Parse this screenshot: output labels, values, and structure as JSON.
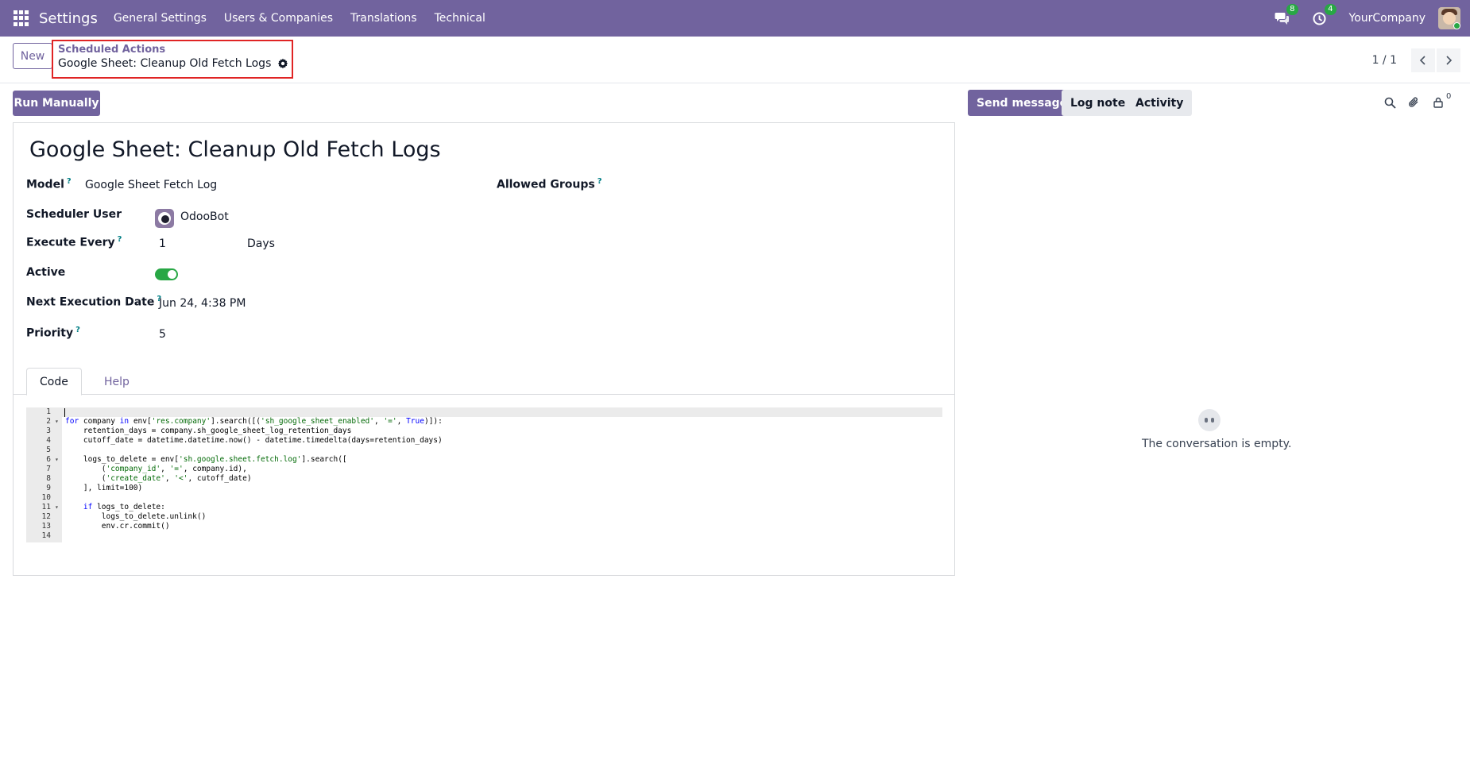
{
  "navbar": {
    "app_title": "Settings",
    "menu": [
      "General Settings",
      "Users & Companies",
      "Translations",
      "Technical"
    ],
    "messages_badge": "8",
    "activities_badge": "4",
    "company": "YourCompany",
    "color": "#71639e"
  },
  "control_panel": {
    "new_label": "New",
    "breadcrumb_parent": "Scheduled Actions",
    "breadcrumb_current": "Google Sheet: Cleanup Old Fetch Logs",
    "pager": "1 / 1"
  },
  "actions": {
    "run_manually": "Run Manually"
  },
  "form": {
    "title": "Google Sheet: Cleanup Old Fetch Logs",
    "model_label": "Model",
    "model_value": "Google Sheet Fetch Log",
    "allowed_groups_label": "Allowed Groups",
    "scheduler_user_label": "Scheduler User",
    "scheduler_user_value": "OdooBot",
    "execute_every_label": "Execute Every",
    "execute_every_value": "1",
    "execute_every_unit": "Days",
    "active_label": "Active",
    "active_value": true,
    "next_execution_label": "Next Execution Date",
    "next_execution_value": "Jun 24, 4:38 PM",
    "priority_label": "Priority",
    "priority_value": "5",
    "help_marker": "?"
  },
  "tabs": [
    "Code",
    "Help"
  ],
  "code_lines": [
    "",
    "for company in env['res.company'].search([('sh_google_sheet_enabled', '=', True)]):",
    "    retention_days = company.sh_google_sheet_log_retention_days",
    "    cutoff_date = datetime.datetime.now() - datetime.timedelta(days=retention_days)",
    "",
    "    logs_to_delete = env['sh.google.sheet.fetch.log'].search([",
    "        ('company_id', '=', company.id),",
    "        ('create_date', '<', cutoff_date)",
    "    ], limit=100)",
    "",
    "    if logs_to_delete:",
    "        logs_to_delete.unlink()",
    "        env.cr.commit()",
    ""
  ],
  "folded_lines": [
    2,
    6,
    11
  ],
  "chatter": {
    "send_message": "Send message",
    "log_note": "Log note",
    "activity": "Activity",
    "followers_count": "0",
    "empty_text": "The conversation is empty."
  },
  "colors": {
    "brand": "#71639e",
    "badge": "#28a745",
    "toggle_on": "#28a745",
    "highlight_border": "#e02424",
    "help_marker": "#017e84"
  }
}
